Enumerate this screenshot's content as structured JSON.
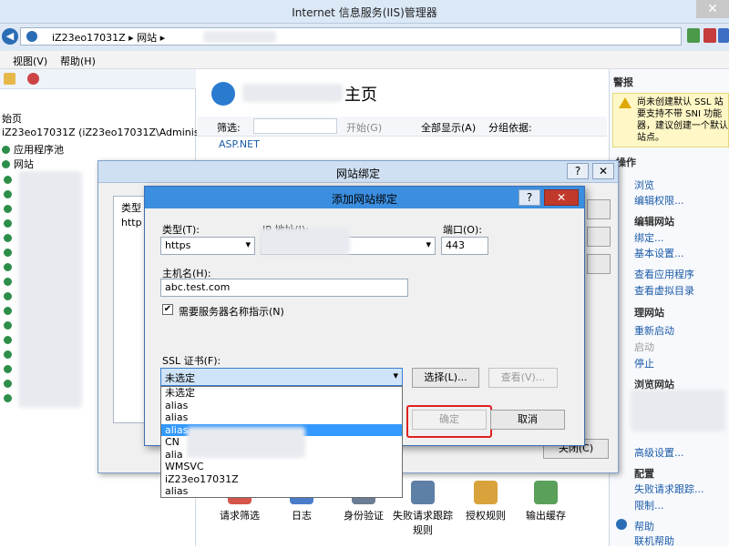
{
  "window": {
    "title": "Internet 信息服务(IIS)管理器",
    "close_glyph": "✕"
  },
  "address": {
    "path": "iZ23eo17031Z  ▸ 网站 ▸",
    "back": "◀",
    "fwd": "▶"
  },
  "menu": {
    "view": "视图(V)",
    "help": "帮助(H)"
  },
  "tree": {
    "nodes": [
      "始页",
      "iZ23eo17031Z (iZ23eo17031Z\\Administrato",
      "应用程序池",
      "网站"
    ]
  },
  "center": {
    "heading_suffix": "主页",
    "filter_label": "筛选:",
    "start_label": "开始(G)",
    "show_all_label": "全部显示(A)",
    "group_label": "分组依据:",
    "aspnet": "ASP.NET",
    "features": [
      "请求筛选",
      "日志",
      "身份验证",
      "失败请求跟踪规则",
      "授权规则",
      "输出缓存"
    ]
  },
  "right_pane": {
    "alerts_title": "警报",
    "warning_lines": [
      "尚未创建默认 SSL 站",
      "要支持不带 SNI 功能",
      "器，建议创建一个默认",
      "站点。"
    ],
    "actions_title": "操作",
    "browse": "浏览",
    "edit_perms": "编辑权限...",
    "edit_site_title": "编辑网站",
    "bindings": "绑定...",
    "basic_settings": "基本设置...",
    "view_apps": "查看应用程序",
    "view_vdirs": "查看虚拟目录",
    "manage_site_title": "理网站",
    "restart": "重新启动",
    "start": "启动",
    "stop": "停止",
    "browse_site_title": "浏览网站",
    "advanced": "高级设置...",
    "config_title": "配置",
    "failed_req": "失败请求跟踪...",
    "limits": "限制...",
    "help": "帮助",
    "online_help": "联机帮助"
  },
  "bindings_dialog": {
    "title": "网站绑定",
    "help_glyph": "?",
    "close_glyph": "✕",
    "col_type": "类型",
    "row_type": "http",
    "close_button": "关闭(C)"
  },
  "add_dialog": {
    "title": "添加网站绑定",
    "type_label": "类型(T):",
    "type_value": "https",
    "ip_label": "IP 地址(I):",
    "port_label": "端口(O):",
    "port_value": "443",
    "host_label": "主机名(H):",
    "host_value": "abc.test.com",
    "sni_label": "需要服务器名称指示(N)",
    "sni_checked": "✔",
    "ssl_label": "SSL 证书(F):",
    "ssl_value": "未选定",
    "ssl_options": [
      "未选定",
      "alias",
      "alias",
      "alias",
      "CN",
      "alia",
      "WMSVC",
      "iZ23eo17031Z",
      "alias"
    ],
    "select_button": "选择(L)...",
    "view_button": "查看(V)...",
    "ok_button": "确定",
    "cancel_button": "取消"
  }
}
